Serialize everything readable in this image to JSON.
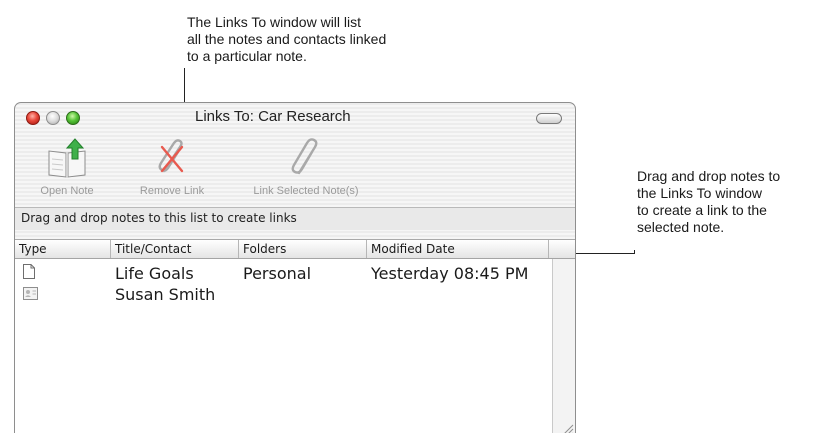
{
  "callouts": {
    "top": [
      "The Links To window will list",
      "all the notes and contacts linked",
      "to a particular note."
    ],
    "right": [
      "Drag and drop notes to",
      "the Links To window",
      "to create a link to the",
      "selected note."
    ]
  },
  "window": {
    "title": "Links To: Car Research"
  },
  "toolbar": {
    "open_note": "Open Note",
    "remove_link": "Remove Link",
    "link_selected": "Link Selected Note(s)"
  },
  "hint": "Drag and drop notes to this list to create links",
  "table": {
    "columns": {
      "type": "Type",
      "title": "Title/Contact",
      "folders": "Folders",
      "modified": "Modified Date"
    },
    "rows": [
      {
        "icon": "note-icon",
        "title": "Life Goals",
        "folders": "Personal",
        "modified": "Yesterday 08:45 PM"
      },
      {
        "icon": "contact-card-icon",
        "title": "Susan Smith",
        "folders": "",
        "modified": ""
      }
    ]
  },
  "colors": {
    "close": "#e8473a",
    "zoom": "#56c437",
    "link_arrow": "#3fb04a",
    "remove_x": "#e85a4f"
  }
}
